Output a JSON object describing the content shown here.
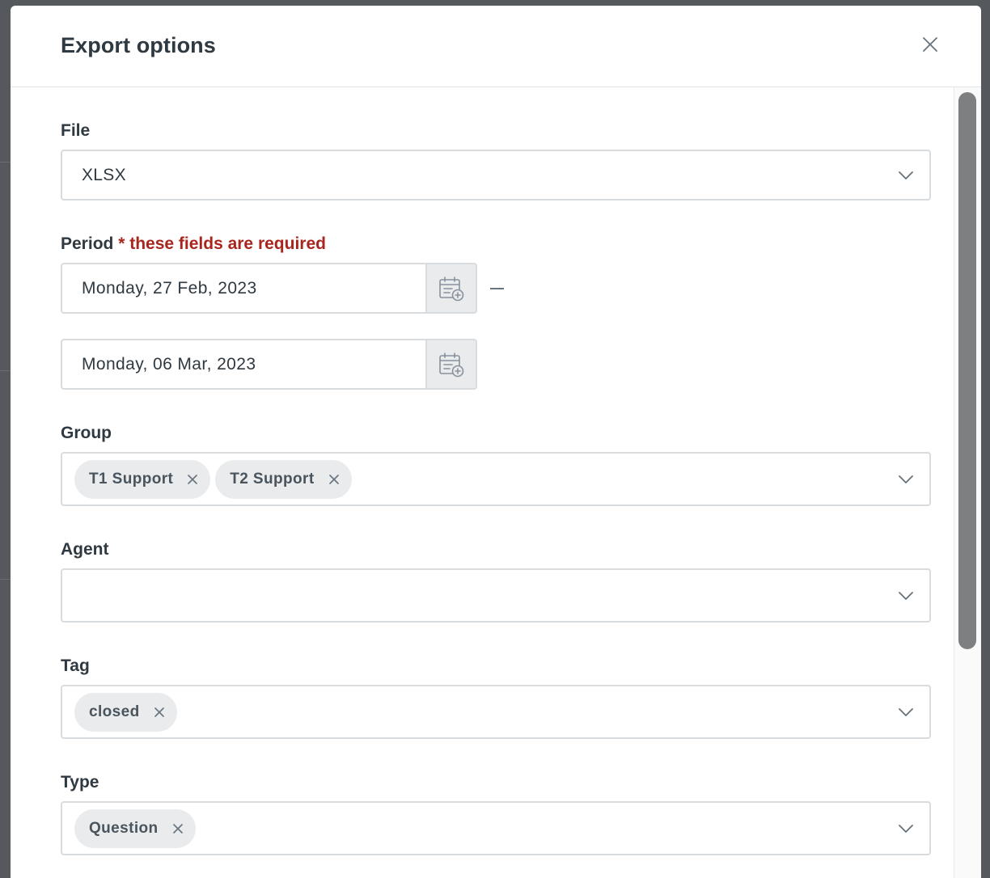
{
  "modal": {
    "title": "Export options"
  },
  "file": {
    "label": "File",
    "value": "XLSX"
  },
  "period": {
    "label": "Period",
    "required_note": "* these fields are required",
    "start": "Monday, 27 Feb, 2023",
    "end": "Monday, 06 Mar, 2023"
  },
  "group": {
    "label": "Group",
    "chips": [
      "T1 Support",
      "T2 Support"
    ]
  },
  "agent": {
    "label": "Agent",
    "value": ""
  },
  "tag": {
    "label": "Tag",
    "chips": [
      "closed"
    ]
  },
  "type": {
    "label": "Type",
    "chips": [
      "Question"
    ]
  },
  "icons": {
    "close": "close-icon",
    "chevron": "chevron-down-icon",
    "calendar": "calendar-add-icon",
    "chip_remove": "x-icon"
  },
  "colors": {
    "required": "#a8261d",
    "chip_bg": "#e9ebed",
    "backdrop": "#55595e"
  }
}
